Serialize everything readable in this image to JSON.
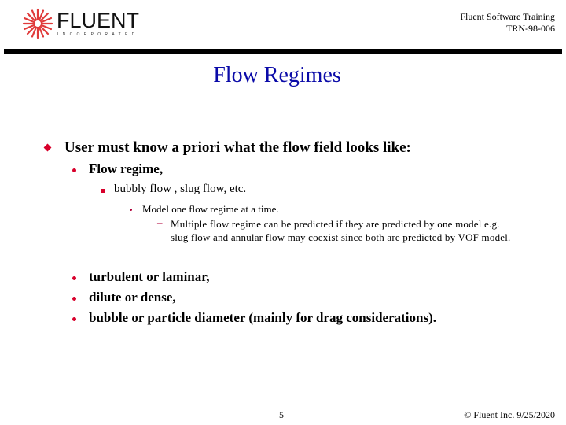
{
  "header": {
    "logo_text": "FLUENT",
    "logo_subtext": "INCORPORATED",
    "course": "Fluent Software Training",
    "doc_code": "TRN-98-006"
  },
  "slide": {
    "title": "Flow Regimes",
    "bullets": {
      "main": "User must know a priori what the flow field looks like:",
      "flow_regime": "Flow regime,",
      "examples": "bubbly flow , slug flow, etc.",
      "model_one": "Model one flow regime at a time.",
      "multiple": "Multiple flow regime can be predicted if they are predicted by one model e.g. slug flow and annular flow may coexist since both are predicted by VOF model.",
      "dash": "–",
      "turbulent": "turbulent or laminar,",
      "dilute": "dilute or dense,",
      "diameter": "bubble or particle diameter (mainly for drag considerations)."
    },
    "colors": {
      "title": "#0a0aa8",
      "bullet": "#d8002b"
    }
  },
  "footer": {
    "page_number": "5",
    "copyright": "© Fluent Inc. 9/25/2020"
  }
}
